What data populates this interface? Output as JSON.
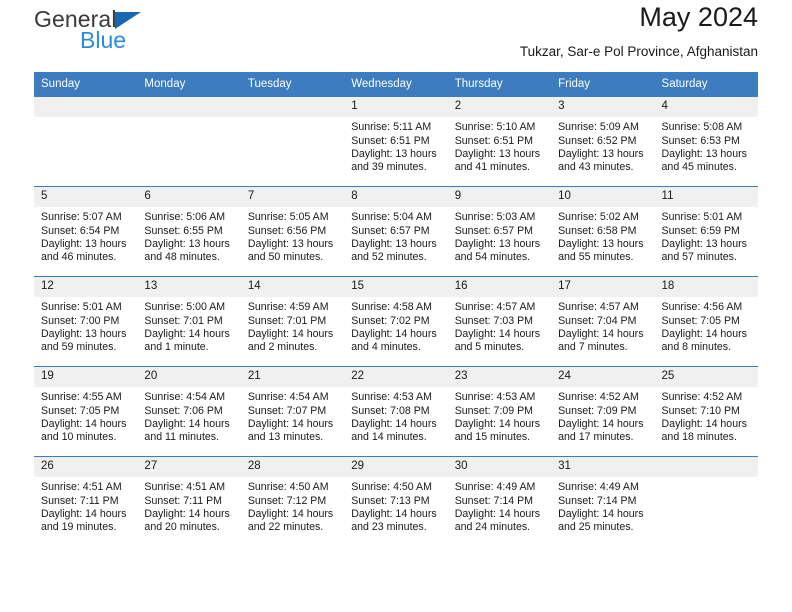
{
  "brand": {
    "line1": "General",
    "line2": "Blue",
    "triangle_color": "#1668b3",
    "line2_color": "#2a8ddb"
  },
  "header": {
    "title": "May 2024",
    "subtitle": "Tukzar, Sar-e Pol Province, Afghanistan"
  },
  "theme": {
    "header_blue": "#3c7cbf",
    "daynum_background": "#f0f0f0",
    "text": "#1a1a1a"
  },
  "weekdays": [
    "Sunday",
    "Monday",
    "Tuesday",
    "Wednesday",
    "Thursday",
    "Friday",
    "Saturday"
  ],
  "weeks": [
    [
      {
        "empty": true
      },
      {
        "empty": true
      },
      {
        "empty": true
      },
      {
        "day": "1",
        "sunrise": "Sunrise: 5:11 AM",
        "sunset": "Sunset: 6:51 PM",
        "daylight": "Daylight: 13 hours and 39 minutes."
      },
      {
        "day": "2",
        "sunrise": "Sunrise: 5:10 AM",
        "sunset": "Sunset: 6:51 PM",
        "daylight": "Daylight: 13 hours and 41 minutes."
      },
      {
        "day": "3",
        "sunrise": "Sunrise: 5:09 AM",
        "sunset": "Sunset: 6:52 PM",
        "daylight": "Daylight: 13 hours and 43 minutes."
      },
      {
        "day": "4",
        "sunrise": "Sunrise: 5:08 AM",
        "sunset": "Sunset: 6:53 PM",
        "daylight": "Daylight: 13 hours and 45 minutes."
      }
    ],
    [
      {
        "day": "5",
        "sunrise": "Sunrise: 5:07 AM",
        "sunset": "Sunset: 6:54 PM",
        "daylight": "Daylight: 13 hours and 46 minutes."
      },
      {
        "day": "6",
        "sunrise": "Sunrise: 5:06 AM",
        "sunset": "Sunset: 6:55 PM",
        "daylight": "Daylight: 13 hours and 48 minutes."
      },
      {
        "day": "7",
        "sunrise": "Sunrise: 5:05 AM",
        "sunset": "Sunset: 6:56 PM",
        "daylight": "Daylight: 13 hours and 50 minutes."
      },
      {
        "day": "8",
        "sunrise": "Sunrise: 5:04 AM",
        "sunset": "Sunset: 6:57 PM",
        "daylight": "Daylight: 13 hours and 52 minutes."
      },
      {
        "day": "9",
        "sunrise": "Sunrise: 5:03 AM",
        "sunset": "Sunset: 6:57 PM",
        "daylight": "Daylight: 13 hours and 54 minutes."
      },
      {
        "day": "10",
        "sunrise": "Sunrise: 5:02 AM",
        "sunset": "Sunset: 6:58 PM",
        "daylight": "Daylight: 13 hours and 55 minutes."
      },
      {
        "day": "11",
        "sunrise": "Sunrise: 5:01 AM",
        "sunset": "Sunset: 6:59 PM",
        "daylight": "Daylight: 13 hours and 57 minutes."
      }
    ],
    [
      {
        "day": "12",
        "sunrise": "Sunrise: 5:01 AM",
        "sunset": "Sunset: 7:00 PM",
        "daylight": "Daylight: 13 hours and 59 minutes."
      },
      {
        "day": "13",
        "sunrise": "Sunrise: 5:00 AM",
        "sunset": "Sunset: 7:01 PM",
        "daylight": "Daylight: 14 hours and 1 minute."
      },
      {
        "day": "14",
        "sunrise": "Sunrise: 4:59 AM",
        "sunset": "Sunset: 7:01 PM",
        "daylight": "Daylight: 14 hours and 2 minutes."
      },
      {
        "day": "15",
        "sunrise": "Sunrise: 4:58 AM",
        "sunset": "Sunset: 7:02 PM",
        "daylight": "Daylight: 14 hours and 4 minutes."
      },
      {
        "day": "16",
        "sunrise": "Sunrise: 4:57 AM",
        "sunset": "Sunset: 7:03 PM",
        "daylight": "Daylight: 14 hours and 5 minutes."
      },
      {
        "day": "17",
        "sunrise": "Sunrise: 4:57 AM",
        "sunset": "Sunset: 7:04 PM",
        "daylight": "Daylight: 14 hours and 7 minutes."
      },
      {
        "day": "18",
        "sunrise": "Sunrise: 4:56 AM",
        "sunset": "Sunset: 7:05 PM",
        "daylight": "Daylight: 14 hours and 8 minutes."
      }
    ],
    [
      {
        "day": "19",
        "sunrise": "Sunrise: 4:55 AM",
        "sunset": "Sunset: 7:05 PM",
        "daylight": "Daylight: 14 hours and 10 minutes."
      },
      {
        "day": "20",
        "sunrise": "Sunrise: 4:54 AM",
        "sunset": "Sunset: 7:06 PM",
        "daylight": "Daylight: 14 hours and 11 minutes."
      },
      {
        "day": "21",
        "sunrise": "Sunrise: 4:54 AM",
        "sunset": "Sunset: 7:07 PM",
        "daylight": "Daylight: 14 hours and 13 minutes."
      },
      {
        "day": "22",
        "sunrise": "Sunrise: 4:53 AM",
        "sunset": "Sunset: 7:08 PM",
        "daylight": "Daylight: 14 hours and 14 minutes."
      },
      {
        "day": "23",
        "sunrise": "Sunrise: 4:53 AM",
        "sunset": "Sunset: 7:09 PM",
        "daylight": "Daylight: 14 hours and 15 minutes."
      },
      {
        "day": "24",
        "sunrise": "Sunrise: 4:52 AM",
        "sunset": "Sunset: 7:09 PM",
        "daylight": "Daylight: 14 hours and 17 minutes."
      },
      {
        "day": "25",
        "sunrise": "Sunrise: 4:52 AM",
        "sunset": "Sunset: 7:10 PM",
        "daylight": "Daylight: 14 hours and 18 minutes."
      }
    ],
    [
      {
        "day": "26",
        "sunrise": "Sunrise: 4:51 AM",
        "sunset": "Sunset: 7:11 PM",
        "daylight": "Daylight: 14 hours and 19 minutes."
      },
      {
        "day": "27",
        "sunrise": "Sunrise: 4:51 AM",
        "sunset": "Sunset: 7:11 PM",
        "daylight": "Daylight: 14 hours and 20 minutes."
      },
      {
        "day": "28",
        "sunrise": "Sunrise: 4:50 AM",
        "sunset": "Sunset: 7:12 PM",
        "daylight": "Daylight: 14 hours and 22 minutes."
      },
      {
        "day": "29",
        "sunrise": "Sunrise: 4:50 AM",
        "sunset": "Sunset: 7:13 PM",
        "daylight": "Daylight: 14 hours and 23 minutes."
      },
      {
        "day": "30",
        "sunrise": "Sunrise: 4:49 AM",
        "sunset": "Sunset: 7:14 PM",
        "daylight": "Daylight: 14 hours and 24 minutes."
      },
      {
        "day": "31",
        "sunrise": "Sunrise: 4:49 AM",
        "sunset": "Sunset: 7:14 PM",
        "daylight": "Daylight: 14 hours and 25 minutes."
      },
      {
        "empty": true
      }
    ]
  ]
}
